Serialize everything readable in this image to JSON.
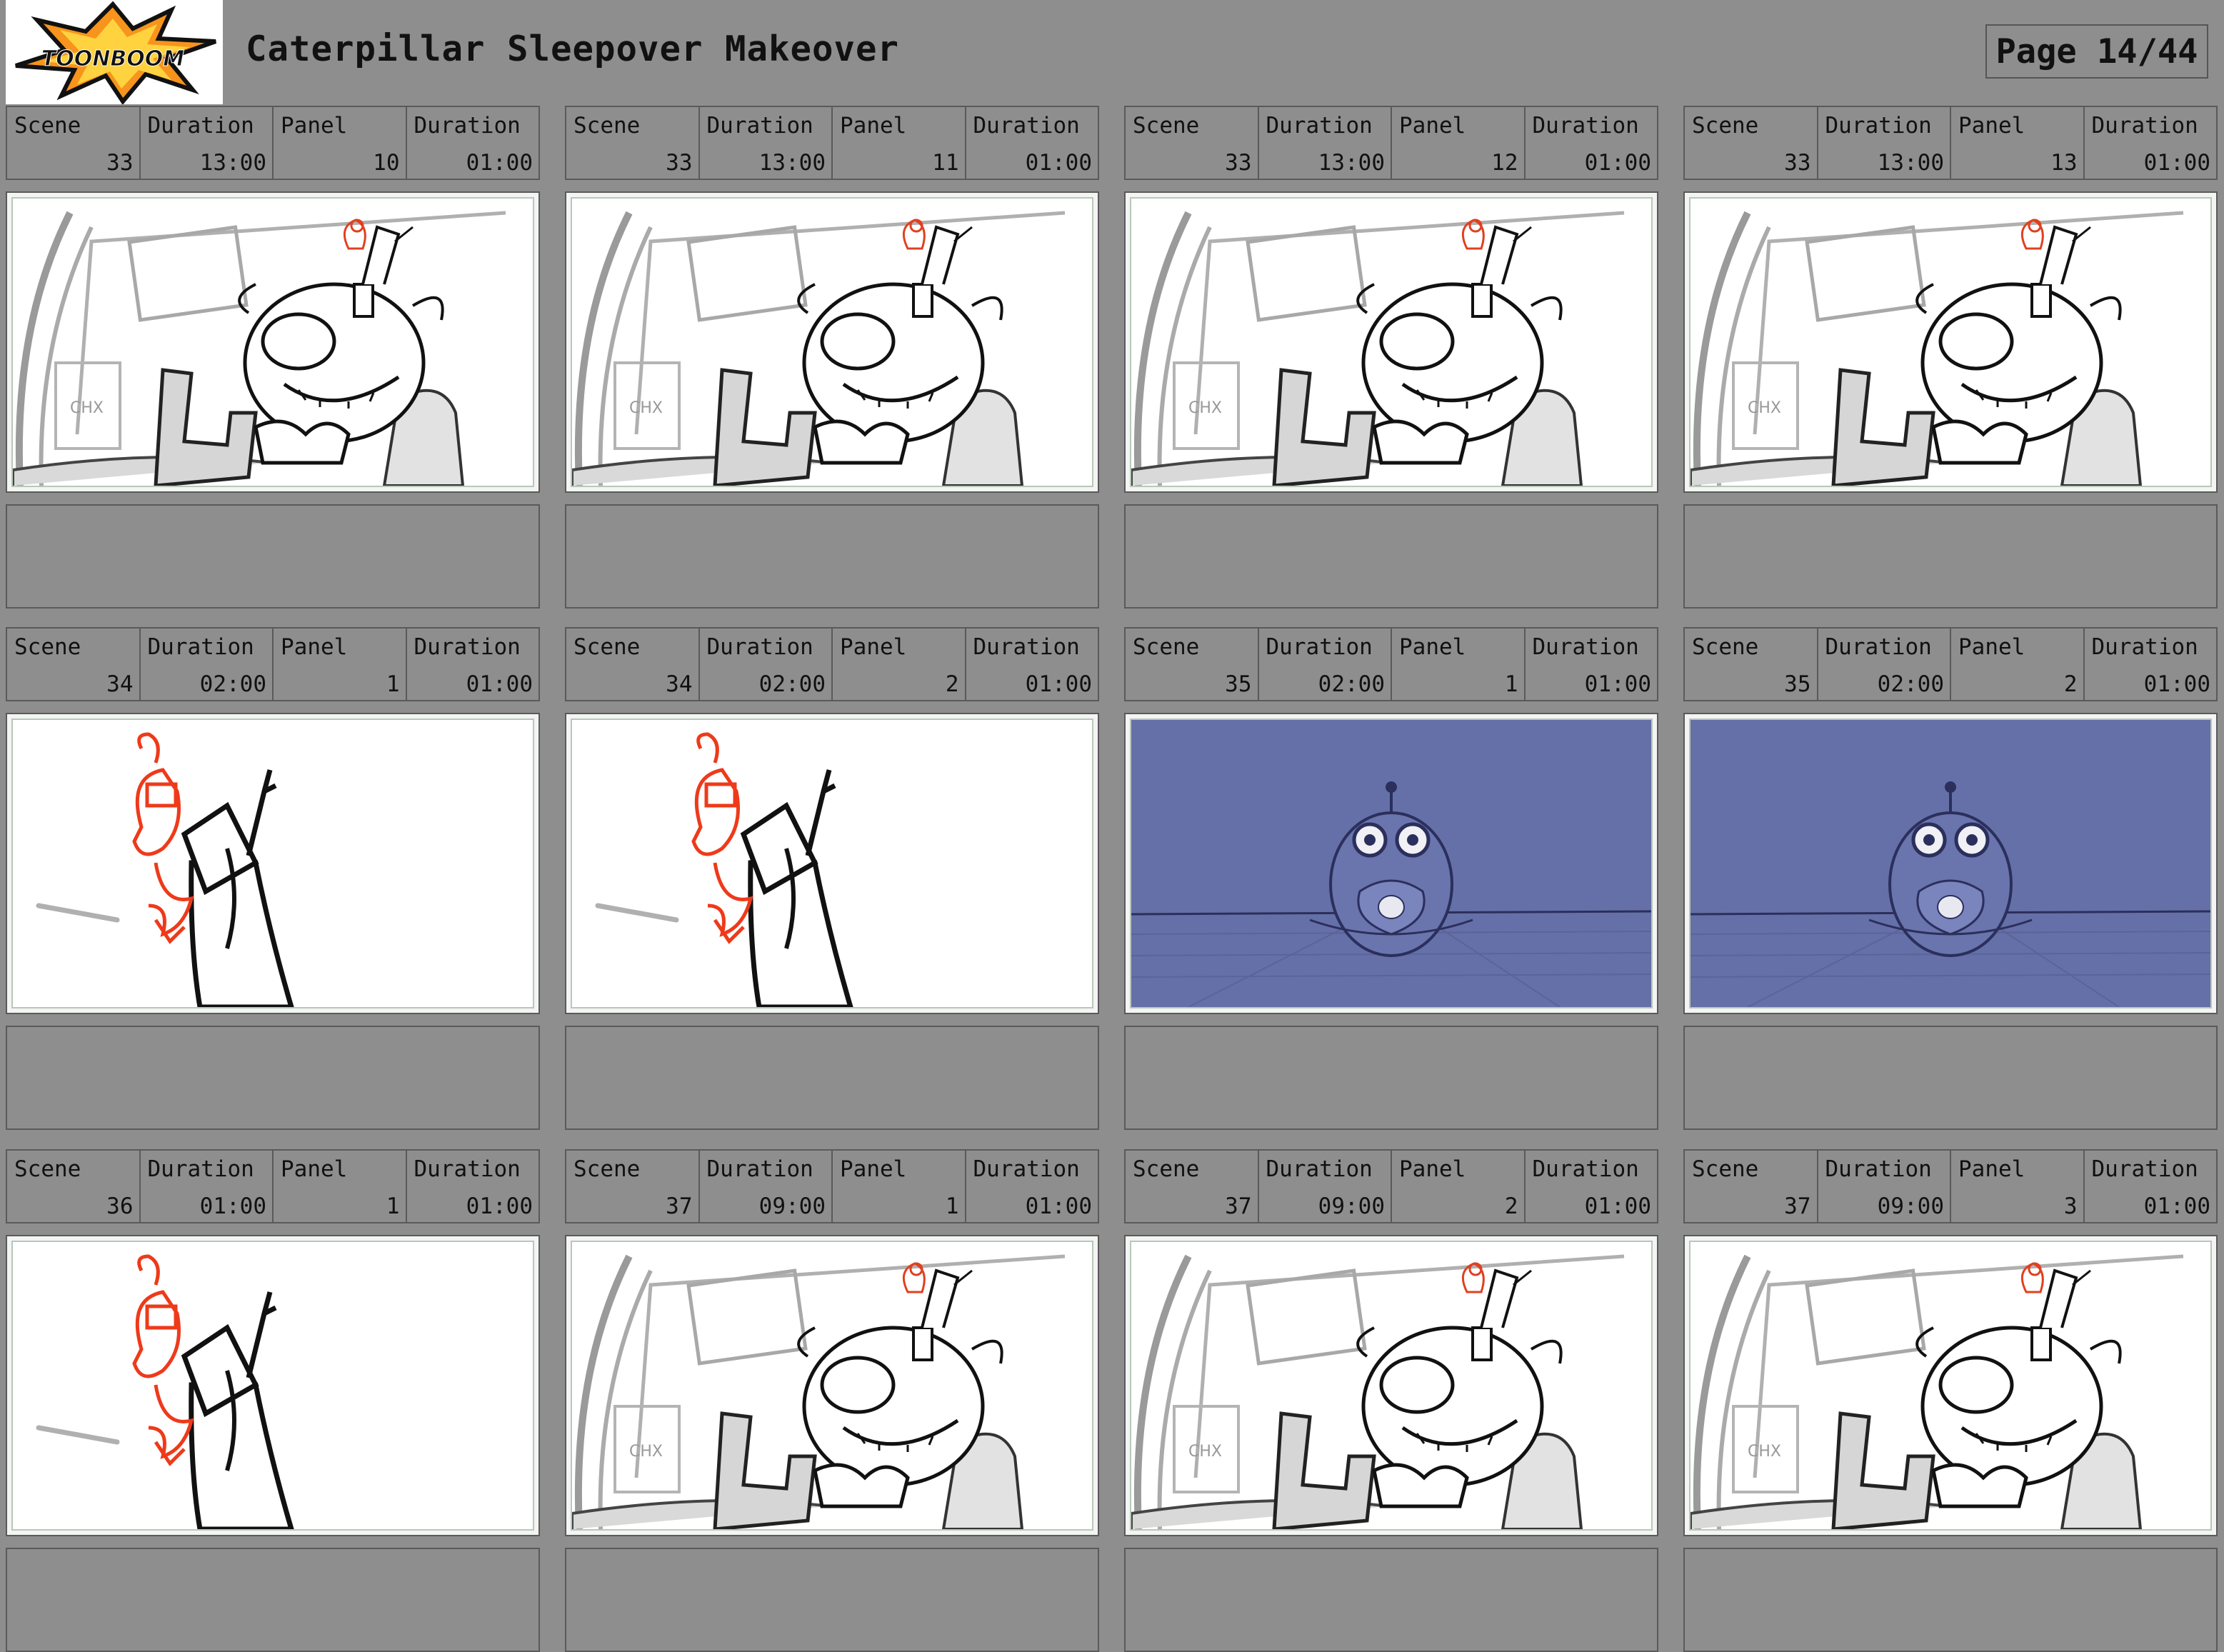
{
  "header": {
    "logo_text": "TOONBOOM",
    "title": "Caterpillar Sleepover Makeover",
    "page": "Page 14/44"
  },
  "labels": {
    "scene": "Scene",
    "duration": "Duration",
    "panel": "Panel"
  },
  "panels": [
    {
      "scene": "33",
      "scene_duration": "13:00",
      "panel": "10",
      "panel_duration": "01:00",
      "art": "sketch-a"
    },
    {
      "scene": "33",
      "scene_duration": "13:00",
      "panel": "11",
      "panel_duration": "01:00",
      "art": "sketch-a"
    },
    {
      "scene": "33",
      "scene_duration": "13:00",
      "panel": "12",
      "panel_duration": "01:00",
      "art": "sketch-a"
    },
    {
      "scene": "33",
      "scene_duration": "13:00",
      "panel": "13",
      "panel_duration": "01:00",
      "art": "sketch-a"
    },
    {
      "scene": "34",
      "scene_duration": "02:00",
      "panel": "1",
      "panel_duration": "01:00",
      "art": "sketch-b"
    },
    {
      "scene": "34",
      "scene_duration": "02:00",
      "panel": "2",
      "panel_duration": "01:00",
      "art": "sketch-b"
    },
    {
      "scene": "35",
      "scene_duration": "02:00",
      "panel": "1",
      "panel_duration": "01:00",
      "art": "sketch-c"
    },
    {
      "scene": "35",
      "scene_duration": "02:00",
      "panel": "2",
      "panel_duration": "01:00",
      "art": "sketch-c"
    },
    {
      "scene": "36",
      "scene_duration": "01:00",
      "panel": "1",
      "panel_duration": "01:00",
      "art": "sketch-b"
    },
    {
      "scene": "37",
      "scene_duration": "09:00",
      "panel": "1",
      "panel_duration": "01:00",
      "art": "sketch-a"
    },
    {
      "scene": "37",
      "scene_duration": "09:00",
      "panel": "2",
      "panel_duration": "01:00",
      "art": "sketch-a"
    },
    {
      "scene": "37",
      "scene_duration": "09:00",
      "panel": "3",
      "panel_duration": "01:00",
      "art": "sketch-a"
    }
  ]
}
